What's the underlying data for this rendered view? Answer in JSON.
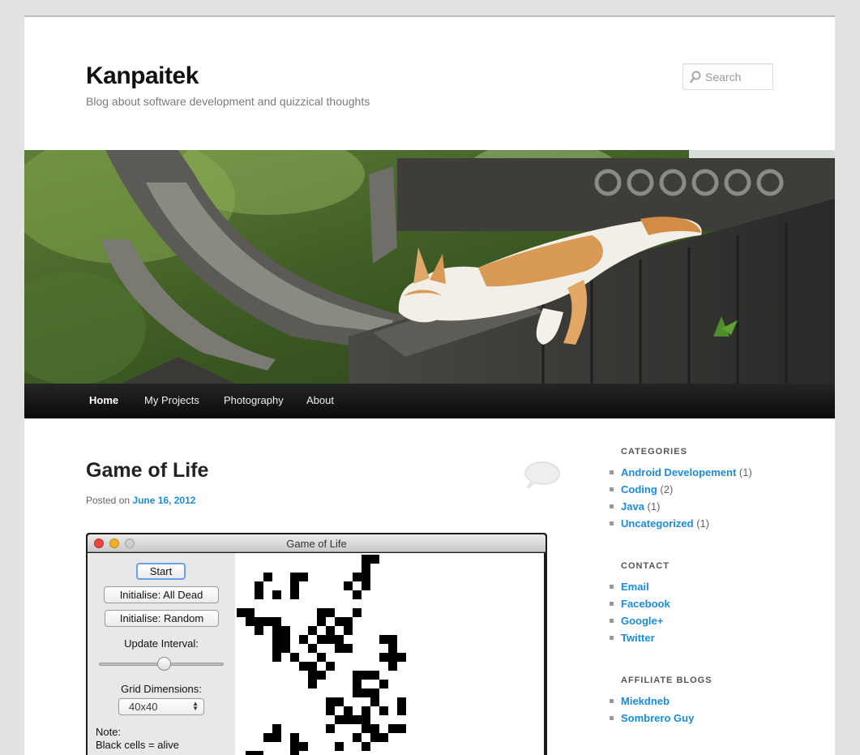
{
  "site": {
    "title": "Kanpaitek",
    "description": "Blog about software development and quizzical thoughts",
    "search_placeholder": "Search"
  },
  "nav": {
    "items": [
      {
        "label": "Home",
        "current": true
      },
      {
        "label": "My Projects",
        "current": false
      },
      {
        "label": "Photography",
        "current": false
      },
      {
        "label": "About",
        "current": false
      }
    ]
  },
  "post": {
    "title": "Game of Life",
    "posted_prefix": "Posted on",
    "date": "June 16, 2012"
  },
  "app_window": {
    "title": "Game of Life",
    "start_label": "Start",
    "init_dead_label": "Initialise: All Dead",
    "init_random_label": "Initialise: Random",
    "interval_label": "Update Interval:",
    "interval_value": 0.52,
    "grid_label": "Grid Dimensions:",
    "grid_value": "40x40",
    "note_label": "Note:",
    "note_text": "Black cells = alive"
  },
  "sidebar": {
    "categories": {
      "title": "CATEGORIES",
      "items": [
        {
          "label": "Android Developement",
          "count": "(1)"
        },
        {
          "label": "Coding",
          "count": "(2)"
        },
        {
          "label": "Java",
          "count": "(1)"
        },
        {
          "label": "Uncategorized",
          "count": "(1)"
        }
      ]
    },
    "contact": {
      "title": "CONTACT",
      "items": [
        {
          "label": "Email"
        },
        {
          "label": "Facebook"
        },
        {
          "label": "Google+"
        },
        {
          "label": "Twitter"
        }
      ]
    },
    "affiliates": {
      "title": "AFFILIATE BLOGS",
      "items": [
        {
          "label": "Miekdneb"
        },
        {
          "label": "Sombrero Guy"
        }
      ]
    }
  },
  "colors": {
    "link": "#1b8be0",
    "nav_bg": "#111111",
    "page_bg": "#e2e2e2"
  }
}
